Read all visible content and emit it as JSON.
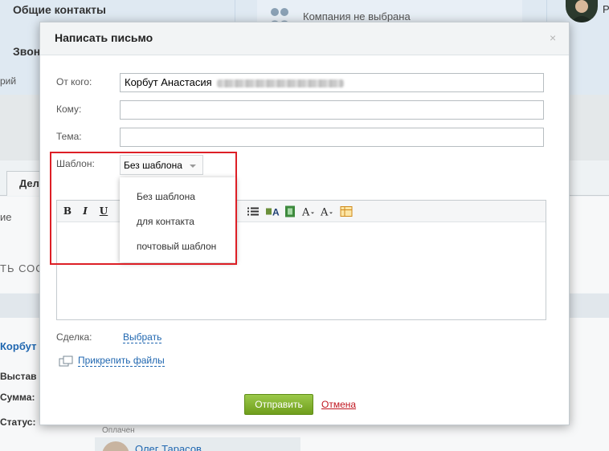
{
  "background": {
    "contacts_title": "Общие контакты",
    "calls_label": "Звон",
    "partial_rij": "рий",
    "company_text": "Компания не выбрана",
    "avatar_letter": "Р",
    "tab_label": "Дел",
    "partial_ie": "ие",
    "partial_soc": "ТЬ СОС",
    "korbut": "Корбут",
    "vystav": "Выстав",
    "summa": "Сумма:",
    "status": "Статус:",
    "oplachen": "Оплачен",
    "oleg": "Олег Тарасов"
  },
  "dialog": {
    "title": "Написать письмо",
    "close_glyph": "×",
    "from_label": "От кого:",
    "from_value": "Корбут Анастасия",
    "to_label": "Кому:",
    "to_value": "",
    "subject_label": "Тема:",
    "subject_value": "",
    "template_label": "Шаблон:",
    "template_selected": "Без шаблона",
    "template_options": [
      "Без шаблона",
      "для контакта",
      "почтовый шаблон"
    ],
    "toolbar": {
      "bold": "B",
      "italic": "I",
      "underline": "U",
      "list": "☷",
      "bgcolor": "A",
      "film": "▦",
      "fontsize": "A",
      "fontsize2": "A",
      "table": "▤"
    },
    "deal_label": "Сделка:",
    "deal_link": "Выбрать",
    "attach_link": "Прикрепить файлы",
    "send_button": "Отправить",
    "cancel_link": "Отмена"
  },
  "colors": {
    "highlight": "#dd1f26",
    "send_button": "#7aa82a",
    "link": "#2067b0",
    "cancel": "#c0161f"
  }
}
